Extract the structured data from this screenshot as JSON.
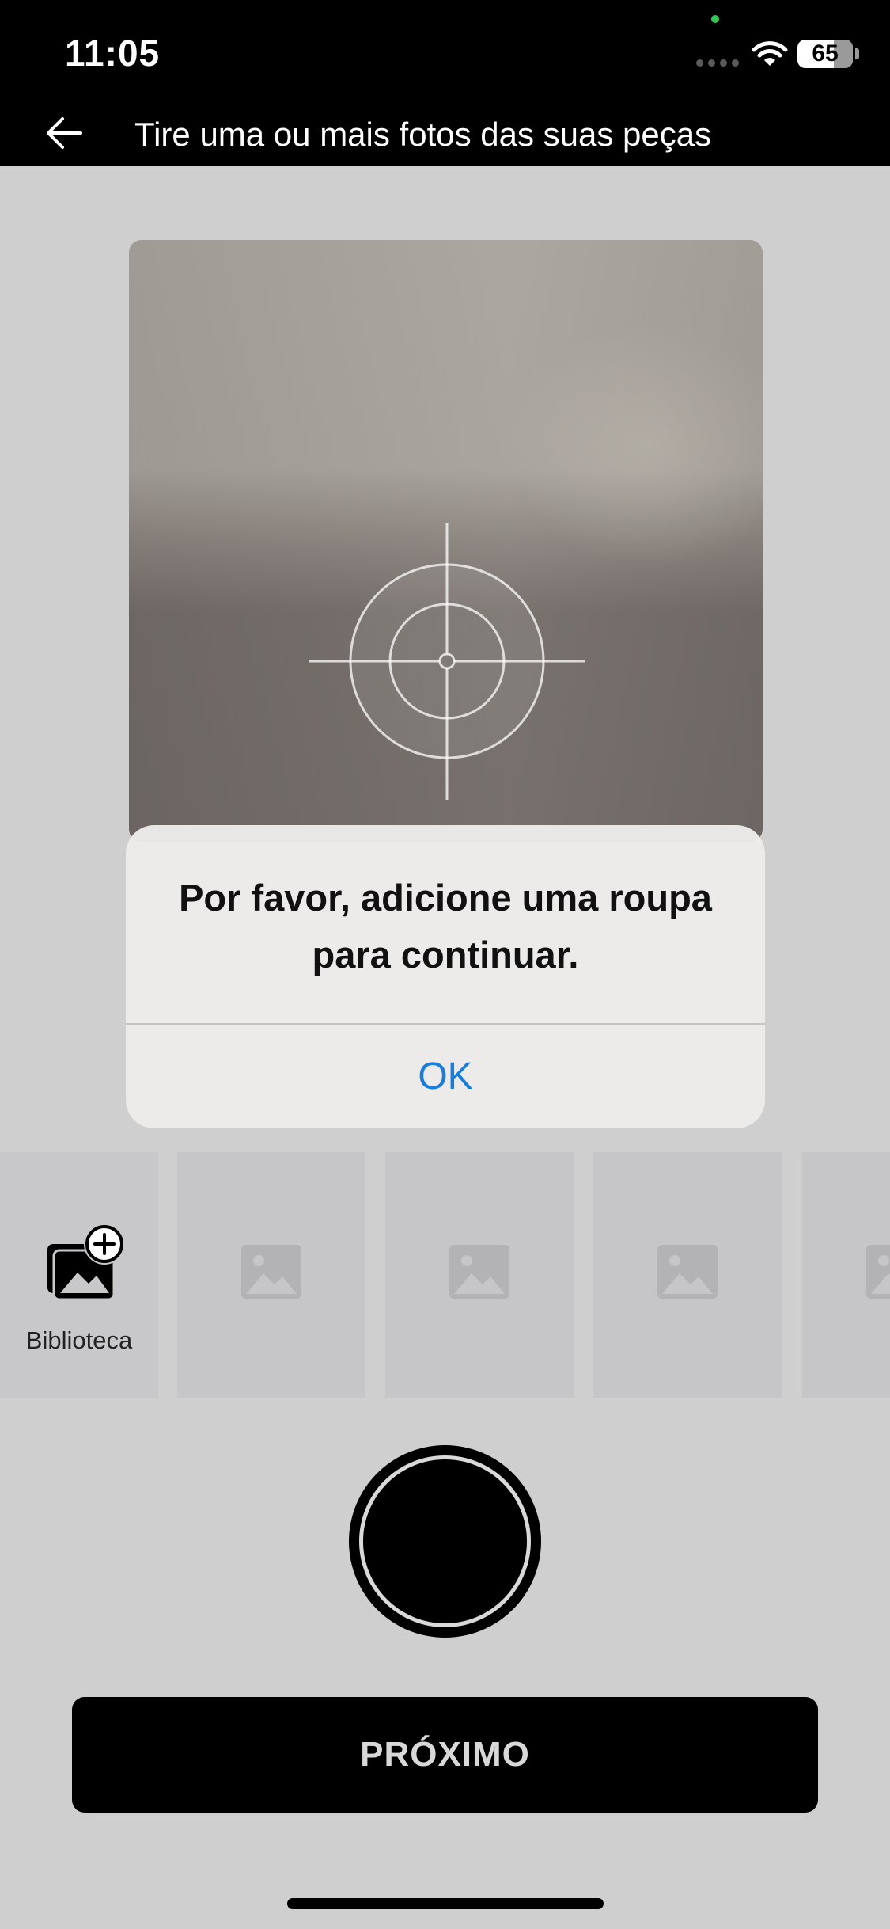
{
  "status_bar": {
    "time": "11:05",
    "battery": "65",
    "icons": [
      "signal-icon",
      "wifi-icon",
      "battery-icon"
    ]
  },
  "header": {
    "back_icon": "arrow-left-icon",
    "title": "Tire uma ou mais fotos das suas peças"
  },
  "camera": {
    "reticle_icon": "focus-reticle-icon"
  },
  "alert": {
    "message": "Por favor, adicione uma roupa para continuar.",
    "ok_label": "OK",
    "ok_color": "#1b7ddb"
  },
  "thumbnails": {
    "library_label": "Biblioteca",
    "library_icon": "add-photo-icon",
    "placeholder_icon": "image-placeholder-icon"
  },
  "actions": {
    "shutter_icon": "shutter-icon",
    "next_label": "PRÓXIMO"
  }
}
